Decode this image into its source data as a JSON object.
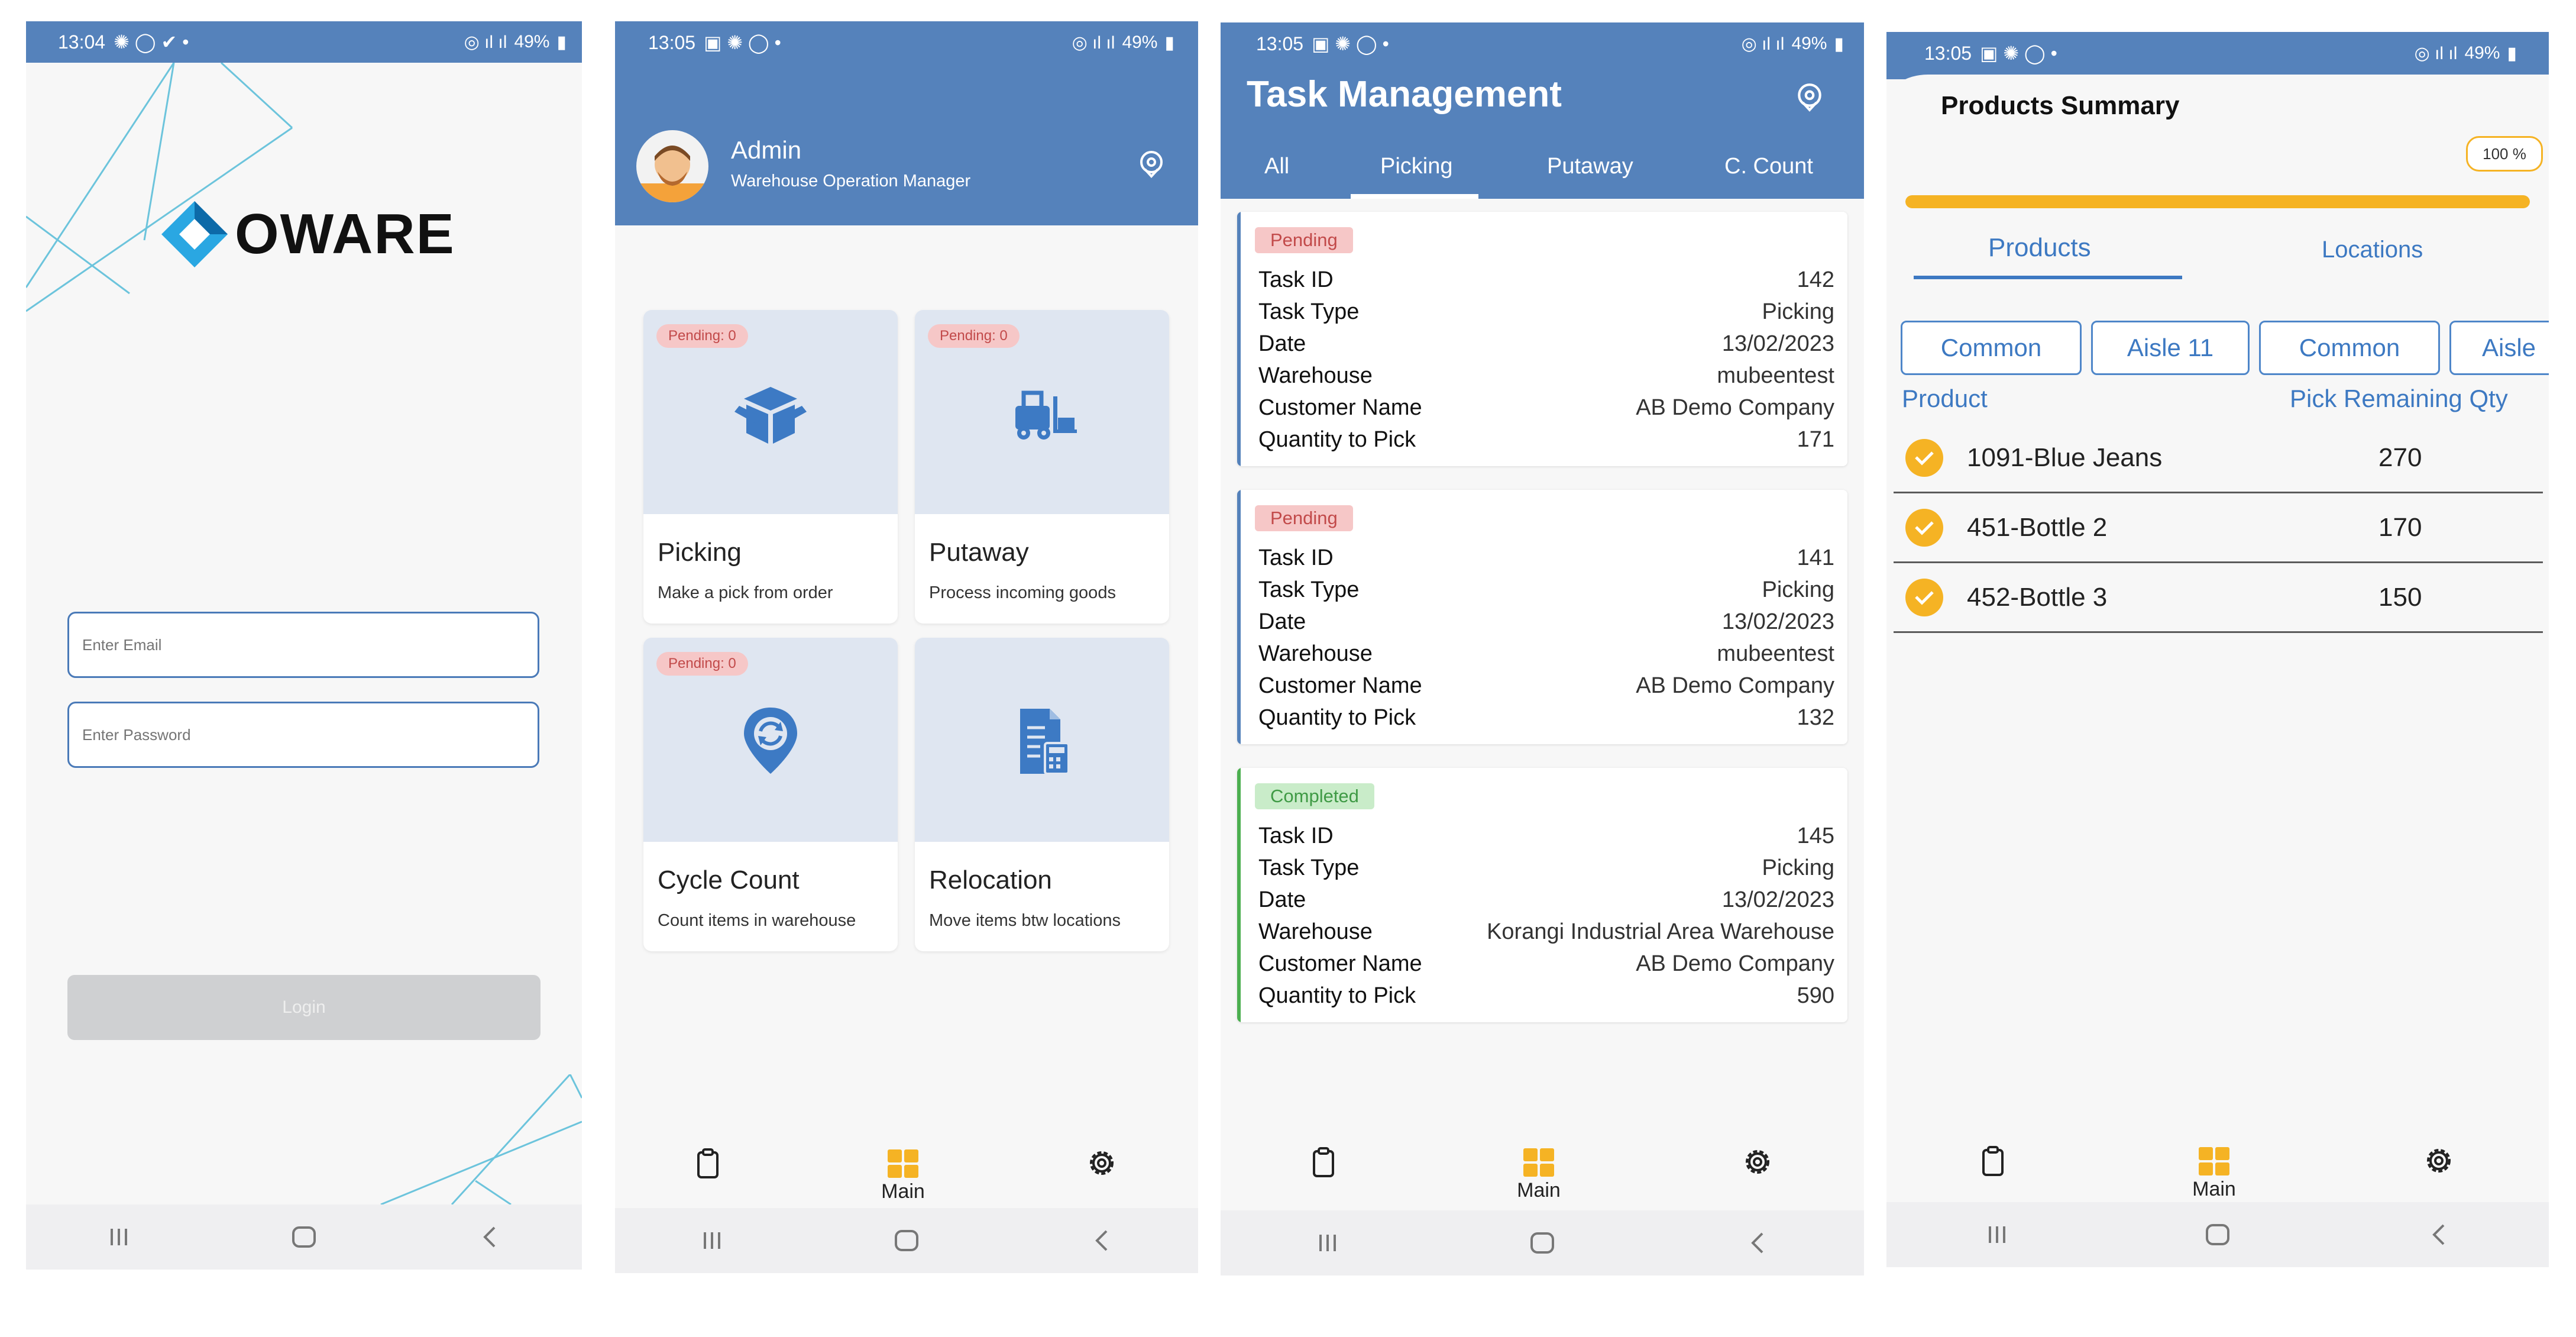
{
  "colors": {
    "primary": "#5582bb",
    "accent": "#f5b324",
    "pending_bg": "#f6c7c7",
    "completed_bg": "#c9ecc9"
  },
  "status_bar": {
    "login": {
      "time": "13:04",
      "battery": "49%"
    },
    "dashboard": {
      "time": "13:05",
      "battery": "49%"
    },
    "tasks": {
      "time": "13:05",
      "battery": "49%"
    },
    "summary": {
      "time": "13:05",
      "battery": "49%"
    }
  },
  "login": {
    "logo_text": "OWARE",
    "email_placeholder": "Enter Email",
    "password_placeholder": "Enter Password",
    "login_label": "Login"
  },
  "dashboard": {
    "user_name": "Admin",
    "user_role": "Warehouse Operation Manager",
    "cards": [
      {
        "title": "Picking",
        "subtitle": "Make a pick from order",
        "pending": "Pending: 0",
        "icon": "box-icon"
      },
      {
        "title": "Putaway",
        "subtitle": "Process incoming goods",
        "pending": "Pending: 0",
        "icon": "forklift-icon"
      },
      {
        "title": "Cycle Count",
        "subtitle": "Count items in warehouse",
        "pending": "Pending: 0",
        "icon": "location-sync-icon"
      },
      {
        "title": "Relocation",
        "subtitle": "Move items btw locations",
        "pending": "",
        "icon": "document-calculator-icon"
      }
    ],
    "main_label": "Main"
  },
  "tasks": {
    "title": "Task Management",
    "tabs": [
      "All",
      "Picking",
      "Putaway",
      "C. Count"
    ],
    "active_tab": "Picking",
    "labels": {
      "task_id": "Task ID",
      "task_type": "Task Type",
      "date": "Date",
      "warehouse": "Warehouse",
      "customer": "Customer Name",
      "qty": "Quantity to Pick"
    },
    "items": [
      {
        "status": "Pending",
        "task_id": "142",
        "task_type": "Picking",
        "date": "13/02/2023",
        "warehouse": "mubeentest",
        "customer": "AB Demo Company",
        "qty": "171"
      },
      {
        "status": "Pending",
        "task_id": "141",
        "task_type": "Picking",
        "date": "13/02/2023",
        "warehouse": "mubeentest",
        "customer": "AB Demo Company",
        "qty": "132"
      },
      {
        "status": "Completed",
        "task_id": "145",
        "task_type": "Picking",
        "date": "13/02/2023",
        "warehouse": "Korangi Industrial Area Warehouse",
        "customer": "AB Demo Company",
        "qty": "590"
      }
    ],
    "main_label": "Main"
  },
  "summary": {
    "title": "Products Summary",
    "progress_label": "100 %",
    "progress": 1.0,
    "tabs": [
      "Products",
      "Locations"
    ],
    "chips": [
      "Common",
      "Aisle 11",
      "Common",
      "Aisle"
    ],
    "col_product": "Product",
    "col_qty": "Pick Remaining Qty",
    "rows": [
      {
        "name": "1091-Blue Jeans",
        "qty": "270"
      },
      {
        "name": "451-Bottle 2",
        "qty": "170"
      },
      {
        "name": "452-Bottle 3",
        "qty": "150"
      }
    ],
    "main_label": "Main"
  }
}
